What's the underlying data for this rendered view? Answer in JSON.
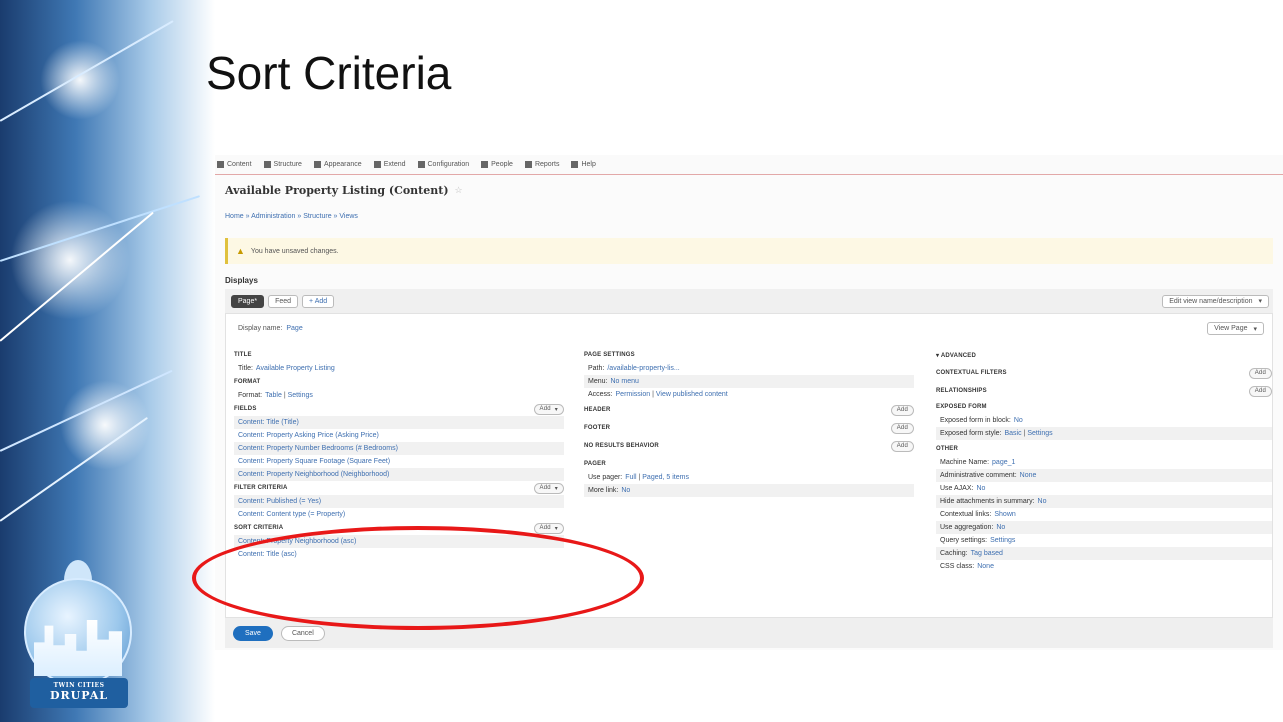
{
  "slide": {
    "title": "Sort Criteria",
    "logo_text": [
      "TWIN CITIES",
      "DRUPAL"
    ]
  },
  "toolbar": {
    "items": [
      {
        "label": "Content",
        "icon": "menu-icon"
      },
      {
        "label": "Structure",
        "icon": "structure-icon"
      },
      {
        "label": "Appearance",
        "icon": "wrench-icon"
      },
      {
        "label": "Extend",
        "icon": "puzzle-icon"
      },
      {
        "label": "Configuration",
        "icon": "wrench-icon"
      },
      {
        "label": "People",
        "icon": "people-icon"
      },
      {
        "label": "Reports",
        "icon": "chart-icon"
      },
      {
        "label": "Help",
        "icon": "help-icon"
      }
    ]
  },
  "page": {
    "title": "Available Property Listing (Content)",
    "breadcrumb": "Home » Administration » Structure » Views",
    "message": "You have unsaved changes.",
    "displays_label": "Displays"
  },
  "tabs": {
    "page": "Page*",
    "feed": "Feed",
    "add": "+ Add",
    "edit_name": "Edit view name/description"
  },
  "display_name": {
    "label": "Display name:",
    "value": "Page"
  },
  "view_page_button": "View Page",
  "col1": {
    "title_section": "TITLE",
    "title_row": {
      "label": "Title:",
      "value": "Available Property Listing"
    },
    "format_section": "FORMAT",
    "format_row": {
      "label": "Format:",
      "value": "Table",
      "sep": "|",
      "settings": "Settings"
    },
    "fields_section": "FIELDS",
    "fields": [
      "Content: Title (Title)",
      "Content: Property Asking Price (Asking Price)",
      "Content: Property Number Bedrooms (# Bedrooms)",
      "Content: Property Square Footage (Square Feet)",
      "Content: Property Neighborhood (Neighborhood)"
    ],
    "filter_section": "FILTER CRITERIA",
    "filters": [
      "Content: Published (= Yes)",
      "Content: Content type (= Property)"
    ],
    "sort_section": "SORT CRITERIA",
    "sorts": [
      "Content: Property Neighborhood (asc)",
      "Content: Title (asc)"
    ],
    "add_label": "Add"
  },
  "col2": {
    "page_settings": "PAGE SETTINGS",
    "path": {
      "label": "Path:",
      "value": "/available-property-lis..."
    },
    "menu": {
      "label": "Menu:",
      "value": "No menu"
    },
    "access": {
      "label": "Access:",
      "value": "Permission",
      "sep": "|",
      "extra": "View published content"
    },
    "header": "HEADER",
    "footer": "FOOTER",
    "no_results": "NO RESULTS BEHAVIOR",
    "pager": "PAGER",
    "use_pager": {
      "label": "Use pager:",
      "value": "Full",
      "sep": "|",
      "extra": "Paged, 5 items"
    },
    "more_link": {
      "label": "More link:",
      "value": "No"
    },
    "add_label": "Add"
  },
  "col3": {
    "advanced": "▾ ADVANCED",
    "contextual": "CONTEXTUAL FILTERS",
    "relationships": "RELATIONSHIPS",
    "exposed_form": "EXPOSED FORM",
    "exposed_rows": [
      {
        "label": "Exposed form in block:",
        "value": "No"
      },
      {
        "label": "Exposed form style:",
        "value": "Basic",
        "sep": "|",
        "extra": "Settings"
      }
    ],
    "other": "OTHER",
    "other_rows": [
      {
        "label": "Machine Name:",
        "value": "page_1"
      },
      {
        "label": "Administrative comment:",
        "value": "None"
      },
      {
        "label": "Use AJAX:",
        "value": "No"
      },
      {
        "label": "Hide attachments in summary:",
        "value": "No"
      },
      {
        "label": "Contextual links:",
        "value": "Shown"
      },
      {
        "label": "Use aggregation:",
        "value": "No"
      },
      {
        "label": "Query settings:",
        "value": "Settings"
      },
      {
        "label": "Caching:",
        "value": "Tag based"
      },
      {
        "label": "CSS class:",
        "value": "None"
      }
    ],
    "add_label": "Add"
  },
  "buttons": {
    "save": "Save",
    "cancel": "Cancel"
  },
  "colors": {
    "accent": "#1f6fbf",
    "link": "#3e6fb0",
    "highlight": "#e81818",
    "warning": "#e0c13e"
  }
}
